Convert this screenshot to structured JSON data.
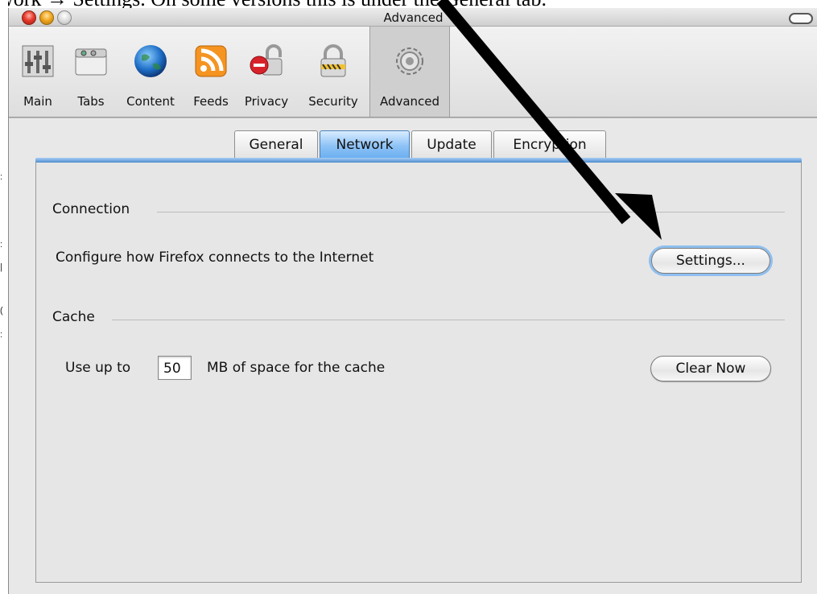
{
  "caption": {
    "text": "work → Settings. On some versions this   is under the General tab."
  },
  "window": {
    "title": "Advanced"
  },
  "toolbar": {
    "items": [
      {
        "label": "Main",
        "icon": "main-icon"
      },
      {
        "label": "Tabs",
        "icon": "tabs-icon"
      },
      {
        "label": "Content",
        "icon": "content-globe-icon"
      },
      {
        "label": "Feeds",
        "icon": "rss-feed-icon"
      },
      {
        "label": "Privacy",
        "icon": "privacy-lock-icon"
      },
      {
        "label": "Security",
        "icon": "security-padlock-icon"
      },
      {
        "label": "Advanced",
        "icon": "advanced-gear-icon"
      }
    ],
    "selected": "Advanced"
  },
  "tabs": {
    "items": [
      "General",
      "Network",
      "Update",
      "Encryption"
    ],
    "active": "Network"
  },
  "connection": {
    "heading": "Connection",
    "description": "Configure how Firefox connects to the Internet",
    "settings_label": "Settings..."
  },
  "cache": {
    "heading": "Cache",
    "prefix": "Use up to",
    "value": "50",
    "suffix": "MB of space for the cache",
    "clear_label": "Clear Now"
  },
  "colors": {
    "active_tab": "#8dc2f6",
    "focus_ring": "#8fbff0",
    "arrow": "#000000"
  }
}
